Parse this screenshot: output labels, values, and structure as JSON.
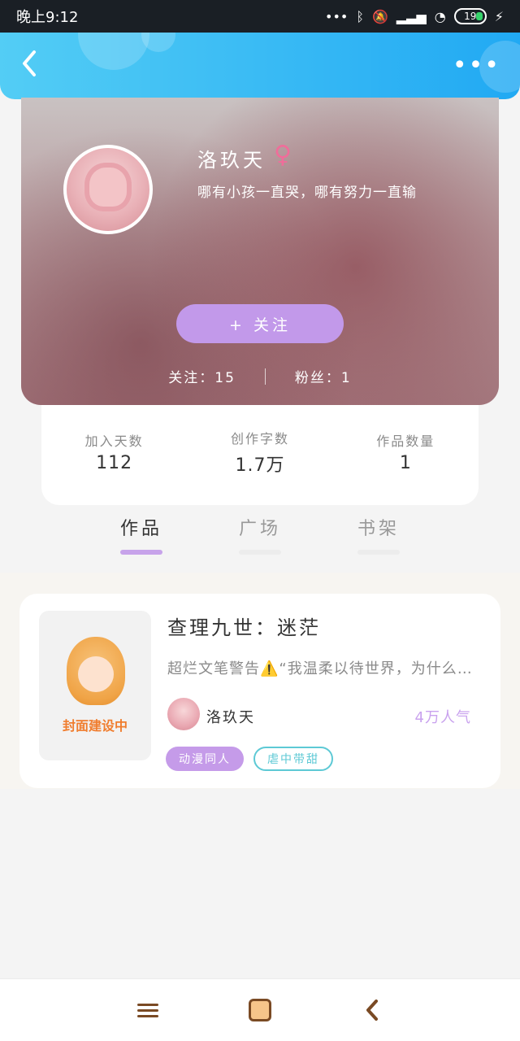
{
  "status_bar": {
    "time": "晚上9:12",
    "icons": [
      "more-dots-icon",
      "bluetooth-icon",
      "mute-icon",
      "signal-icon",
      "wifi-icon",
      "battery-icon",
      "charging-icon"
    ],
    "battery": "19"
  },
  "header": {
    "back_icon": "chevron-left-icon",
    "more_icon": "more-dots-icon",
    "gradient": [
      "#53cdf5",
      "#21a9f3"
    ]
  },
  "profile": {
    "name": "洛玖天",
    "gender": "♀",
    "motto": "哪有小孩一直哭，哪有努力一直输",
    "follow_button": "+ 关注",
    "following": "关注：15",
    "fans": "粉丝：1"
  },
  "stats": [
    {
      "label": "加入天数",
      "value": "112"
    },
    {
      "label": "创作字数",
      "value": "1.7万"
    },
    {
      "label": "作品数量",
      "value": "1"
    }
  ],
  "tabs": [
    {
      "label": "作品",
      "active": true
    },
    {
      "label": "广场",
      "active": false
    },
    {
      "label": "书架",
      "active": false
    }
  ],
  "works": [
    {
      "cover_text": "封面建设中",
      "title": "查理九世：迷茫",
      "description": "超烂文笔警告⚠️“我温柔以待世界，为什么世界对我不温柔”",
      "author": "洛玖天",
      "popularity": "4万人气",
      "tags": [
        "动漫同人",
        "虐中带甜"
      ]
    }
  ],
  "bottom_nav": {
    "items": [
      "menu-icon",
      "home-icon",
      "back-icon"
    ]
  },
  "colors": {
    "accent_purple": "#c299ea",
    "teal_tag": "#5dc9d5",
    "gender_pink": "#f06d9a"
  }
}
